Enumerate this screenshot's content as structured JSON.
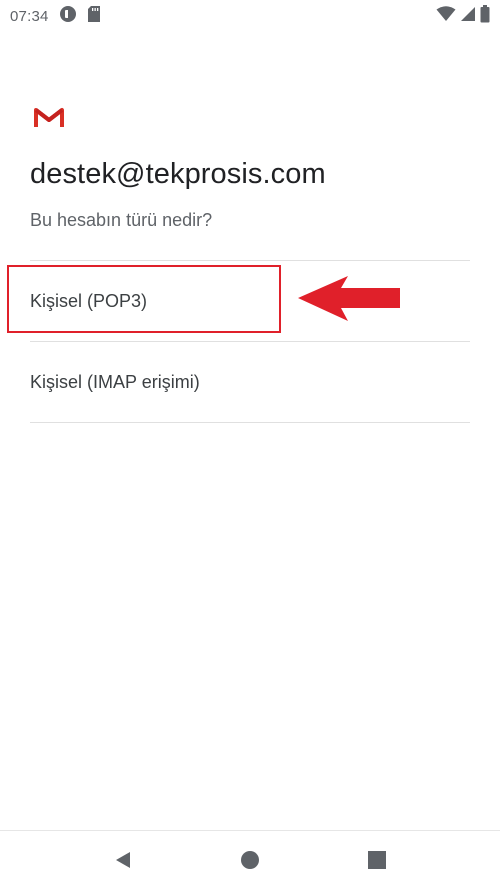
{
  "status_bar": {
    "time": "07:34",
    "icons_left": [
      "data-saver-icon",
      "sd-card-icon"
    ],
    "icons_right": [
      "wifi-icon",
      "signal-icon",
      "battery-icon"
    ]
  },
  "app": {
    "logo": "gmail-icon",
    "account_email": "destek@tekprosis.com",
    "question": "Bu hesabın türü nedir?"
  },
  "options": [
    {
      "label": "Kişisel (POP3)",
      "highlighted": true
    },
    {
      "label": "Kişisel (IMAP erişimi)",
      "highlighted": false
    }
  ],
  "annotation": {
    "color": "#e0202a",
    "shape": "arrow-left"
  },
  "nav_bar": {
    "buttons": [
      "back-icon",
      "home-icon",
      "recents-icon"
    ]
  },
  "colors": {
    "gmail_red": "#d93025",
    "text_primary": "#202124",
    "text_secondary": "#5f6368",
    "highlight": "#e0202a"
  }
}
